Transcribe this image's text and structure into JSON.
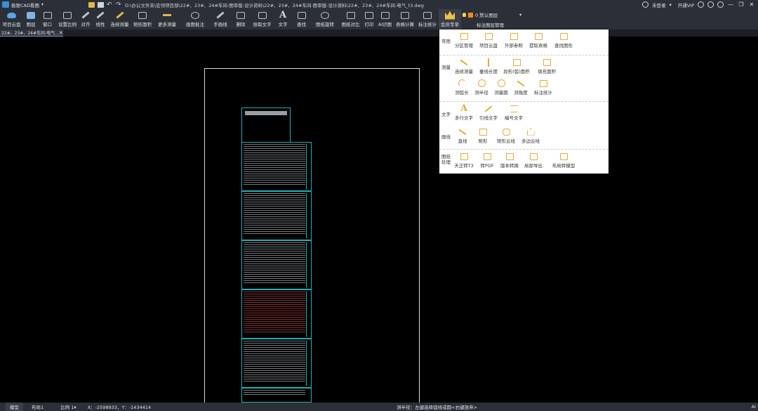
{
  "titlebar": {
    "app_name": "极限CAD看图",
    "file_path": "D:\\办公文件夹\\宏领项目部\\22#、23#、24#车间-图审版-设计资料\\22#、23#、24#车间-图审版-设计资料\\22#、23#、24#车间-电气_t3.dwg",
    "login": "未登录",
    "vip": "开通VIP",
    "minimize": "—",
    "maximize": "❐",
    "close": "✕"
  },
  "toolbar": {
    "items": [
      {
        "label": "项目云盘",
        "icon": "cloud-icon"
      },
      {
        "label": "图层",
        "icon": "layers-icon"
      },
      {
        "label": "窗口",
        "icon": "window-icon"
      },
      {
        "label": "设置比例",
        "icon": "scale-icon"
      },
      {
        "label": "对齐",
        "icon": "align-icon"
      },
      {
        "label": "线性",
        "icon": "linear-icon"
      },
      {
        "label": "连续测量",
        "icon": "measure-icon"
      },
      {
        "label": "矩形面积",
        "icon": "rect-area-icon"
      },
      {
        "label": "更多测量",
        "icon": "more-measure-icon"
      },
      {
        "label": "画图批注",
        "icon": "annotate-icon"
      },
      {
        "label": "手画线",
        "icon": "freehand-icon"
      },
      {
        "label": "删除",
        "icon": "delete-icon"
      },
      {
        "label": "拾取文字",
        "icon": "pick-text-icon"
      },
      {
        "label": "文字",
        "icon": "text-icon"
      },
      {
        "label": "查找",
        "icon": "find-icon"
      },
      {
        "label": "图纸旋转",
        "icon": "rotate-icon"
      },
      {
        "label": "图纸对比",
        "icon": "compare-icon"
      },
      {
        "label": "打印",
        "icon": "print-icon"
      },
      {
        "label": "AI识图",
        "icon": "ai-icon"
      },
      {
        "label": "表格计算",
        "icon": "table-calc-icon"
      },
      {
        "label": "标注统计",
        "icon": "dim-stats-icon"
      },
      {
        "label": "会员专享",
        "icon": "vip-crown-icon"
      }
    ]
  },
  "layer": {
    "current": "0 默认图层",
    "manager": "标注图层管理"
  },
  "doc_tab": {
    "name": "22#、23#、24#车间-电气..."
  },
  "member_menu": {
    "groups": [
      {
        "title": "常用",
        "items": [
          "分区管理",
          "项目云盘",
          "外部参照",
          "提取表格",
          "查找图形"
        ]
      },
      {
        "title": "测量",
        "items": [
          "连续测量",
          "垂线长度",
          "异形(弧)面积",
          "填充面积",
          "测弧长",
          "测半径",
          "测量圆",
          "测角度",
          "标注统计"
        ]
      },
      {
        "title": "文字",
        "items": [
          "多行文字",
          "引线文字",
          "编号文字"
        ]
      },
      {
        "title": "画线",
        "items": [
          "直线",
          "矩形",
          "矩形云线",
          "多边云线"
        ]
      },
      {
        "title": "图纸处理",
        "items": [
          "天正转T3",
          "转PDF",
          "版本转换",
          "局部导出",
          "布局转模型"
        ]
      }
    ]
  },
  "statusbar": {
    "tab_model": "模型",
    "tab_layout": "布局1",
    "scale": "比例 1",
    "coords": "X：-2598933，Y：-1434414",
    "command": "测半径：左键选择弧线或圆<右键放弃>",
    "right": "AI"
  },
  "colors": {
    "ui_bg": "#2b3038",
    "sheet_border": "#1bb2b8",
    "menu_icon": "#e8a93a",
    "layer_color": "#f08a1e"
  }
}
